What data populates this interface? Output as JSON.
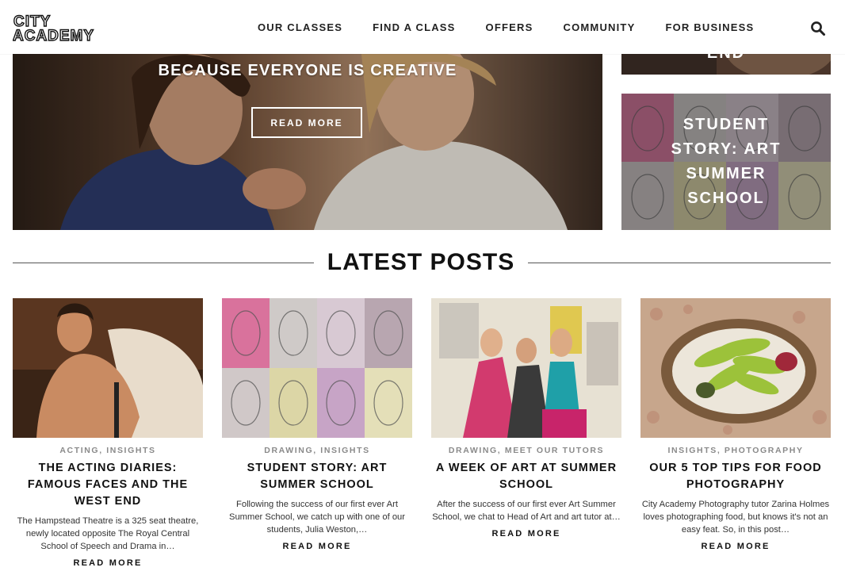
{
  "brand": {
    "name": "CITY ACADEMY"
  },
  "nav": {
    "items": [
      {
        "label": "OUR CLASSES"
      },
      {
        "label": "FIND A CLASS"
      },
      {
        "label": "OFFERS"
      },
      {
        "label": "COMMUNITY"
      },
      {
        "label": "FOR BUSINESS"
      }
    ],
    "search_icon": "search-icon"
  },
  "hero": {
    "tagline": "BECAUSE EVERYONE IS CREATIVE",
    "button_label": "READ MORE"
  },
  "side_tiles": {
    "top_title": "END",
    "bottom_title": "STUDENT STORY: ART SUMMER SCHOOL"
  },
  "latest": {
    "title": "LATEST POSTS",
    "posts": [
      {
        "categories": [
          "ACTING",
          "INSIGHTS"
        ],
        "title": "THE ACTING DIARIES: FAMOUS FACES AND THE WEST END",
        "excerpt": "The Hampstead Theatre is a 325 seat theatre, newly located opposite The Royal Central School of Speech and Drama in…",
        "more": "READ MORE"
      },
      {
        "categories": [
          "DRAWING",
          "INSIGHTS"
        ],
        "title": "STUDENT STORY: ART SUMMER SCHOOL",
        "excerpt": "Following the success of our first ever Art Summer School, we catch up with one of our students, Julia Weston,…",
        "more": "READ MORE"
      },
      {
        "categories": [
          "DRAWING",
          "MEET OUR TUTORS"
        ],
        "title": "A WEEK OF ART AT SUMMER SCHOOL",
        "excerpt": "After the success of our first ever Art Summer School, we chat to Head of Art and art tutor at…",
        "more": "READ MORE"
      },
      {
        "categories": [
          "INSIGHTS",
          "PHOTOGRAPHY"
        ],
        "title": "OUR 5 TOP TIPS FOR FOOD PHOTOGRAPHY",
        "excerpt": "City Academy Photography tutor Zarina Holmes loves photographing food, but knows it's not an easy feat. So, in this post…",
        "more": "READ MORE"
      }
    ]
  }
}
